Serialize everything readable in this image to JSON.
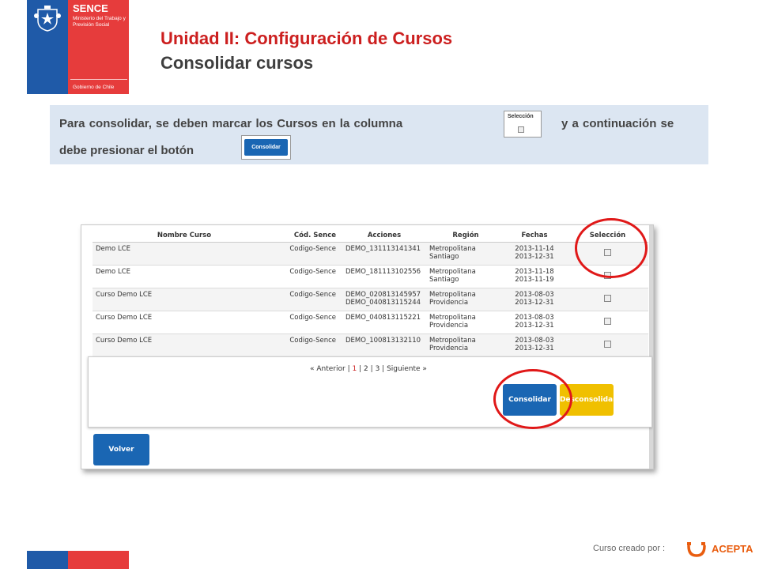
{
  "logo": {
    "name": "SENCE",
    "ministry": "Ministerio del Trabajo y Previsión Social",
    "government": "Gobierno de Chile"
  },
  "header": {
    "title": "Unidad II: Configuración de Cursos",
    "subtitle": "Consolidar cursos"
  },
  "instructions": {
    "part1": "Para consolidar, se deben marcar los Cursos en la columna",
    "part2": "y a continuación se",
    "part3": "debe presionar el botón",
    "selection_thumb_label": "Selección",
    "button_thumb_label": "Consolidar"
  },
  "table": {
    "headers": [
      "Nombre Curso",
      "Cód. Sence",
      "Acciones",
      "Región",
      "Fechas",
      "Selección"
    ],
    "rows": [
      {
        "nombre": "Demo LCE",
        "codigo": "Codigo-Sence",
        "acciones1": "DEMO_131113141341",
        "acciones2": "",
        "region1": "Metropolitana",
        "region2": "Santiago",
        "fecha1": "2013-11-14",
        "fecha2": "2013-12-31"
      },
      {
        "nombre": "Demo LCE",
        "codigo": "Codigo-Sence",
        "acciones1": "DEMO_181113102556",
        "acciones2": "",
        "region1": "Metropolitana",
        "region2": "Santiago",
        "fecha1": "2013-11-18",
        "fecha2": "2013-11-19"
      },
      {
        "nombre": "Curso Demo LCE",
        "codigo": "Codigo-Sence",
        "acciones1": "DEMO_020813145957",
        "acciones2": "DEMO_040813115244",
        "region1": "Metropolitana",
        "region2": "Providencia",
        "fecha1": "2013-08-03",
        "fecha2": "2013-12-31"
      },
      {
        "nombre": "Curso Demo LCE",
        "codigo": "Codigo-Sence",
        "acciones1": "DEMO_040813115221",
        "acciones2": "",
        "region1": "Metropolitana",
        "region2": "Providencia",
        "fecha1": "2013-08-03",
        "fecha2": "2013-12-31"
      },
      {
        "nombre": "Curso Demo LCE",
        "codigo": "Codigo-Sence",
        "acciones1": "DEMO_100813132110",
        "acciones2": "",
        "region1": "Metropolitana",
        "region2": "Providencia",
        "fecha1": "2013-08-03",
        "fecha2": "2013-12-31"
      }
    ]
  },
  "pagination": {
    "prev": "« Anterior",
    "sep": "|",
    "pages": [
      "1",
      "2",
      "3"
    ],
    "next": "Siguiente »"
  },
  "buttons": {
    "consolidar": "Consolidar",
    "desconsolidar": "Desconsolidar",
    "volver": "Volver"
  },
  "footer": {
    "credit": "Curso creado por :",
    "brand": "ACEPTA"
  },
  "colors": {
    "title_red": "#cc1f1f",
    "primary_blue": "#1a66b3",
    "yellow": "#f0c000",
    "highlight_red": "#e01818",
    "info_bg": "#dce6f2"
  }
}
